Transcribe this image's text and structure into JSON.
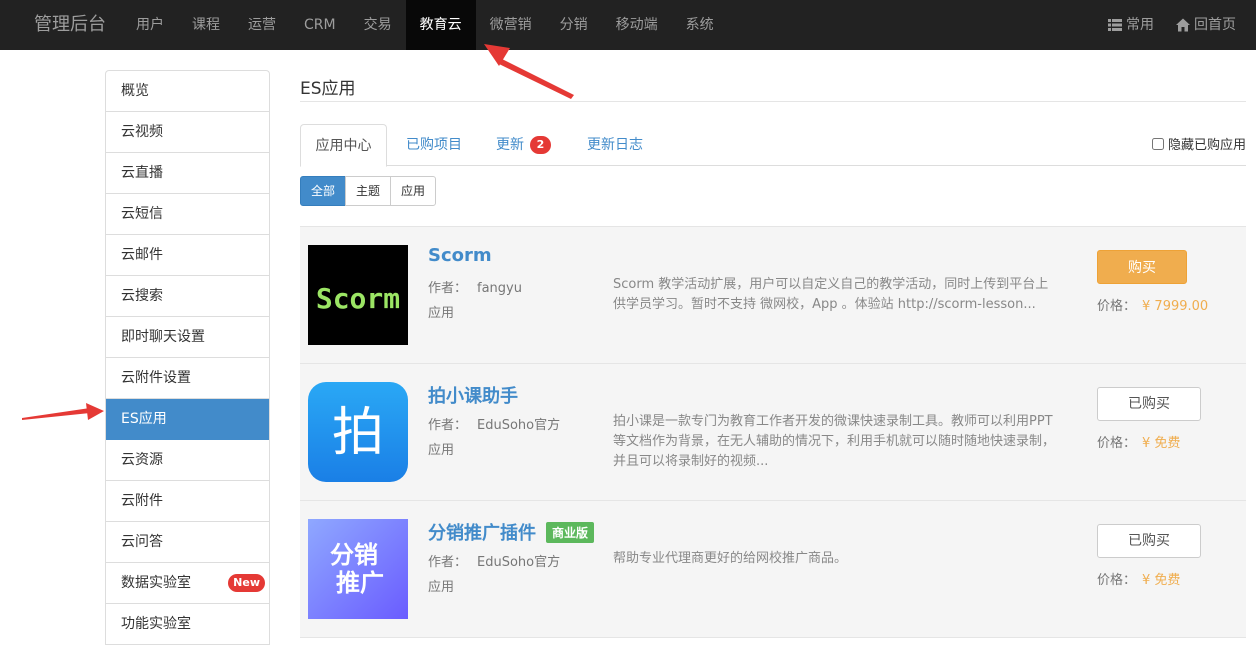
{
  "navbar": {
    "brand": "管理后台",
    "items": [
      {
        "label": "用户"
      },
      {
        "label": "课程"
      },
      {
        "label": "运营"
      },
      {
        "label": "CRM"
      },
      {
        "label": "交易"
      },
      {
        "label": "教育云"
      },
      {
        "label": "微营销"
      },
      {
        "label": "分销"
      },
      {
        "label": "移动端"
      },
      {
        "label": "系统"
      }
    ],
    "active_item": "教育云",
    "right": {
      "common_label": "常用",
      "home_label": "回首页"
    }
  },
  "sidebar": {
    "items": [
      {
        "label": "概览"
      },
      {
        "label": "云视频"
      },
      {
        "label": "云直播"
      },
      {
        "label": "云短信"
      },
      {
        "label": "云邮件"
      },
      {
        "label": "云搜索"
      },
      {
        "label": "即时聊天设置"
      },
      {
        "label": "云附件设置"
      },
      {
        "label": "ES应用"
      },
      {
        "label": "云资源"
      },
      {
        "label": "云附件"
      },
      {
        "label": "云问答"
      },
      {
        "label": "数据实验室",
        "badge": "New"
      },
      {
        "label": "功能实验室"
      }
    ],
    "active_item": "ES应用"
  },
  "main": {
    "title": "ES应用",
    "tabs": [
      {
        "label": "应用中心"
      },
      {
        "label": "已购项目"
      },
      {
        "label": "更新",
        "count": "2"
      },
      {
        "label": "更新日志"
      }
    ],
    "hide_purchased_label": "隐藏已购应用",
    "filters": [
      {
        "label": "全部"
      },
      {
        "label": "主题"
      },
      {
        "label": "应用"
      }
    ],
    "apps": [
      {
        "name": "Scorm",
        "thumb_text": "Scorm",
        "author_label": "作者：",
        "author": "fangyu",
        "type": "应用",
        "description": "Scorm 教学活动扩展，用户可以自定义自己的教学活动，同时上传到平台上供学员学习。暂时不支持 微网校，App 。体验站 http://scorm-lesson...",
        "action": "购买",
        "price_label": "价格：",
        "price": "¥ 7999.00"
      },
      {
        "name": "拍小课助手",
        "thumb_text": "拍",
        "author_label": "作者：",
        "author": "EduSoho官方",
        "type": "应用",
        "description": "拍小课是一款专门为教育工作者开发的微课快速录制工具。教师可以利用PPT等文档作为背景，在无人辅助的情况下，利用手机就可以随时随地快速录制，并且可以将录制好的视频...",
        "action": "已购买",
        "price_label": "价格：",
        "price": "¥ 免费"
      },
      {
        "name": "分销推广插件",
        "edition": "商业版",
        "thumb_line1": "分销",
        "thumb_line2": "推广",
        "author_label": "作者：",
        "author": "EduSoho官方",
        "type": "应用",
        "description": "帮助专业代理商更好的给网校推广商品。",
        "action": "已购买",
        "price_label": "价格：",
        "price": "¥ 免费"
      }
    ]
  },
  "colors": {
    "navbar_bg": "#222222",
    "accent": "#428bca",
    "buy_button": "#f0ad4e",
    "badge": "#e53935",
    "annotation_arrow": "#e53935"
  }
}
